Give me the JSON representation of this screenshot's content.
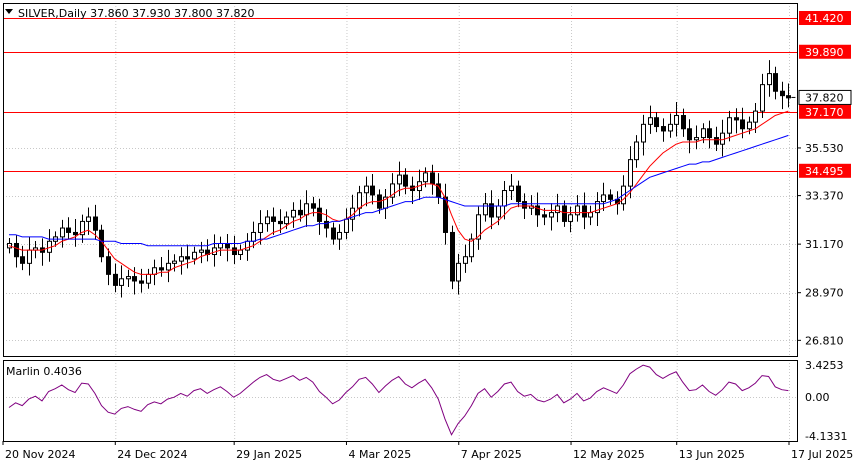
{
  "header": {
    "symbol_line": "SILVER,Daily  37.860 37.930 37.800 37.820"
  },
  "oscillator": {
    "label": "Marlin 0.4036",
    "ticks": [
      "3.4253",
      "0.00",
      "-4.1331"
    ]
  },
  "colors": {
    "background": "#ffffff",
    "grid": "#c8c8c8",
    "axis": "#000000",
    "level_line": "#ff0000",
    "level_label_bg": "#ff0000",
    "level_label_text": "#ffffff",
    "price_label_bg": "#ffffff",
    "candle": "#000000",
    "ma_fast": "#ff0000",
    "ma_slow": "#0000ff",
    "oscillator": "#800080"
  },
  "chart_data": [
    {
      "type": "candlestick",
      "title": "SILVER,Daily",
      "ohlc_last": {
        "open": 37.86,
        "high": 37.93,
        "low": 37.8,
        "close": 37.82
      },
      "x_tick_labels": [
        "20 Nov 2024",
        "24 Dec 2024",
        "29 Jan 2025",
        "4 Mar 2025",
        "7 Apr 2025",
        "12 May 2025",
        "13 Jun 2025",
        "17 Jul 2025"
      ],
      "y_tick_labels": [
        "35.530",
        "33.370",
        "31.170",
        "28.970",
        "26.810"
      ],
      "ylim": [
        26.1,
        42.1
      ],
      "grid": true,
      "levels": [
        {
          "label": "41.420",
          "value": 41.42
        },
        {
          "label": "39.890",
          "value": 39.89
        },
        {
          "label": "37.170",
          "value": 37.17
        },
        {
          "label": "34.495",
          "value": 34.495
        }
      ],
      "current_price": {
        "label": "37.820",
        "value": 37.82
      },
      "approx_close_series": [
        31.2,
        30.6,
        30.3,
        30.9,
        31.0,
        30.8,
        31.3,
        31.5,
        31.9,
        31.7,
        31.6,
        32.2,
        32.4,
        31.8,
        30.6,
        29.8,
        29.3,
        29.6,
        29.7,
        29.5,
        29.4,
        29.8,
        30.1,
        30.0,
        30.3,
        30.4,
        30.6,
        30.5,
        30.8,
        30.9,
        30.7,
        31.0,
        31.2,
        31.0,
        30.7,
        30.9,
        31.3,
        31.7,
        32.1,
        32.4,
        32.2,
        32.1,
        32.4,
        32.7,
        32.5,
        33.0,
        32.8,
        32.2,
        31.9,
        31.4,
        31.7,
        32.3,
        32.8,
        33.5,
        33.8,
        33.4,
        32.8,
        33.3,
        33.9,
        34.3,
        33.8,
        33.6,
        34.0,
        34.4,
        33.9,
        33.3,
        31.7,
        29.5,
        30.3,
        30.6,
        31.4,
        32.5,
        33.0,
        32.4,
        32.9,
        33.6,
        33.8,
        33.1,
        32.8,
        32.9,
        32.5,
        32.4,
        32.6,
        32.9,
        32.2,
        32.5,
        32.9,
        32.4,
        32.6,
        33.1,
        33.4,
        33.2,
        33.0,
        33.8,
        35.0,
        35.8,
        36.6,
        36.9,
        36.5,
        36.3,
        36.6,
        37.0,
        36.4,
        35.9,
        36.0,
        36.4,
        36.0,
        35.7,
        36.2,
        36.9,
        36.8,
        36.4,
        36.7,
        37.2,
        38.4,
        38.9,
        38.1,
        37.9,
        37.8
      ],
      "series": [
        {
          "name": "",
          "role": "fast moving average",
          "values": [
            31.1,
            31.0,
            30.9,
            30.9,
            30.9,
            30.9,
            31.0,
            31.1,
            31.3,
            31.4,
            31.5,
            31.7,
            31.8,
            31.6,
            31.3,
            30.9,
            30.5,
            30.3,
            30.1,
            29.9,
            29.8,
            29.8,
            29.8,
            29.9,
            29.9,
            30.1,
            30.2,
            30.3,
            30.4,
            30.6,
            30.7,
            30.8,
            30.9,
            30.9,
            30.9,
            30.9,
            31.0,
            31.1,
            31.3,
            31.5,
            31.7,
            31.8,
            32.0,
            32.2,
            32.3,
            32.5,
            32.6,
            32.6,
            32.5,
            32.3,
            32.2,
            32.3,
            32.5,
            32.8,
            33.0,
            33.1,
            33.1,
            33.2,
            33.4,
            33.6,
            33.7,
            33.7,
            33.8,
            33.9,
            33.9,
            33.8,
            33.3,
            32.5,
            31.8,
            31.4,
            31.3,
            31.5,
            31.8,
            32.0,
            32.2,
            32.5,
            32.8,
            32.9,
            32.9,
            32.9,
            32.8,
            32.7,
            32.7,
            32.7,
            32.6,
            32.6,
            32.6,
            32.6,
            32.6,
            32.7,
            32.8,
            32.9,
            33.0,
            33.2,
            33.5,
            33.9,
            34.3,
            34.7,
            35.0,
            35.3,
            35.5,
            35.7,
            35.8,
            35.8,
            35.8,
            35.9,
            35.9,
            35.9,
            35.9,
            36.0,
            36.1,
            36.2,
            36.3,
            36.4,
            36.6,
            36.8,
            37.0,
            37.1,
            37.2
          ]
        },
        {
          "name": "",
          "role": "slow moving average",
          "values": [
            31.6,
            31.6,
            31.5,
            31.5,
            31.5,
            31.5,
            31.4,
            31.4,
            31.4,
            31.4,
            31.4,
            31.4,
            31.4,
            31.4,
            31.3,
            31.3,
            31.3,
            31.2,
            31.2,
            31.2,
            31.2,
            31.1,
            31.1,
            31.1,
            31.1,
            31.1,
            31.1,
            31.1,
            31.1,
            31.1,
            31.1,
            31.2,
            31.2,
            31.2,
            31.2,
            31.2,
            31.3,
            31.3,
            31.4,
            31.4,
            31.5,
            31.6,
            31.7,
            31.8,
            31.9,
            32.0,
            32.0,
            32.1,
            32.1,
            32.2,
            32.2,
            32.3,
            32.4,
            32.5,
            32.6,
            32.6,
            32.7,
            32.8,
            32.9,
            33.0,
            33.1,
            33.1,
            33.2,
            33.3,
            33.3,
            33.3,
            33.2,
            33.1,
            33.0,
            32.9,
            32.9,
            32.9,
            32.9,
            32.9,
            32.9,
            32.9,
            33.0,
            33.0,
            33.0,
            33.0,
            33.0,
            33.0,
            33.0,
            33.0,
            33.0,
            33.0,
            33.0,
            33.0,
            33.0,
            33.0,
            33.0,
            33.1,
            33.2,
            33.4,
            33.6,
            33.8,
            34.0,
            34.2,
            34.3,
            34.4,
            34.5,
            34.6,
            34.7,
            34.8,
            34.8,
            34.9,
            34.9,
            35.0,
            35.1,
            35.2,
            35.3,
            35.4,
            35.5,
            35.6,
            35.7,
            35.8,
            35.9,
            36.0,
            36.1
          ]
        }
      ]
    },
    {
      "type": "line",
      "title": "Marlin 0.4036",
      "y_tick_labels": [
        "3.4253",
        "0.00",
        "-4.1331"
      ],
      "ylim": [
        -4.1331,
        3.4253
      ],
      "grid": true,
      "series": [
        {
          "name": "",
          "values": [
            -1.1,
            -0.6,
            -0.9,
            -0.2,
            0.1,
            -0.4,
            0.6,
            0.9,
            1.3,
            0.8,
            0.5,
            1.5,
            1.4,
            0.4,
            -0.9,
            -1.6,
            -1.8,
            -1.2,
            -1.0,
            -1.3,
            -1.5,
            -0.8,
            -0.5,
            -0.7,
            -0.2,
            0.0,
            0.4,
            0.1,
            0.7,
            0.9,
            0.4,
            0.8,
            1.1,
            0.6,
            0.0,
            0.4,
            1.0,
            1.6,
            2.1,
            2.4,
            1.9,
            1.7,
            2.0,
            2.3,
            1.8,
            2.1,
            1.6,
            0.6,
            0.0,
            -0.7,
            -0.3,
            0.5,
            1.1,
            1.9,
            2.1,
            1.4,
            0.5,
            1.2,
            1.8,
            2.2,
            1.4,
            1.0,
            1.5,
            1.9,
            1.0,
            -0.2,
            -2.3,
            -4.0,
            -2.8,
            -2.0,
            -0.9,
            0.4,
            0.9,
            0.0,
            0.6,
            1.4,
            1.6,
            0.6,
            0.1,
            0.3,
            -0.3,
            -0.5,
            -0.2,
            0.3,
            -0.6,
            -0.2,
            0.4,
            -0.4,
            -0.1,
            0.6,
            1.0,
            0.7,
            0.4,
            1.3,
            2.5,
            3.0,
            3.4,
            3.2,
            2.4,
            2.0,
            2.4,
            2.7,
            1.6,
            0.7,
            0.8,
            1.3,
            0.6,
            0.2,
            0.8,
            1.6,
            1.4,
            0.7,
            1.0,
            1.5,
            2.3,
            2.2,
            1.1,
            0.8,
            0.7
          ]
        }
      ]
    }
  ]
}
